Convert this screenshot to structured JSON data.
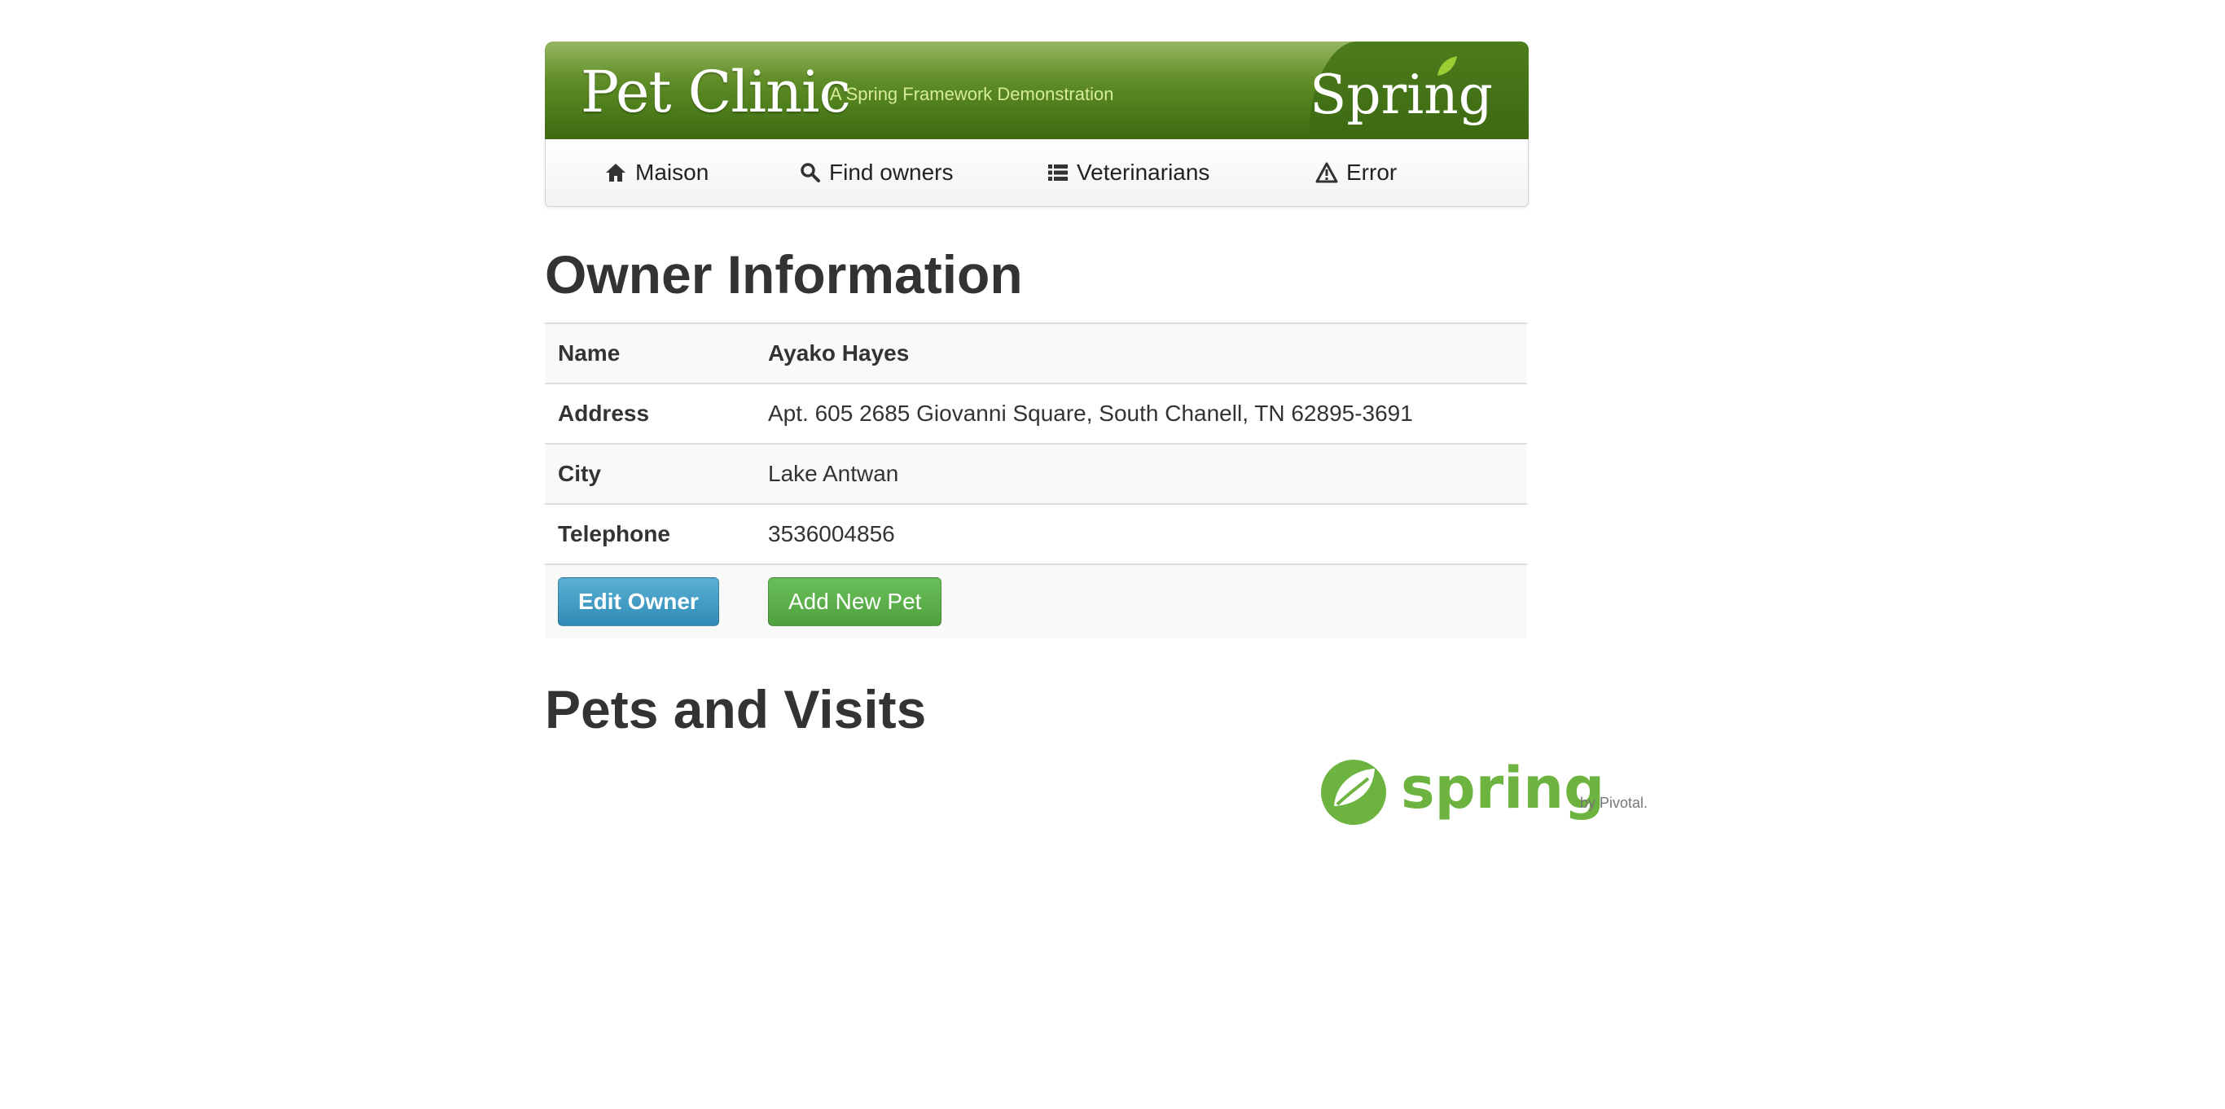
{
  "header": {
    "brand_title": "Pet Clinic",
    "brand_subtitle": "A Spring Framework Demonstration",
    "spring_word": "Spring"
  },
  "nav": {
    "items": [
      {
        "label": "Maison",
        "icon": "home-icon"
      },
      {
        "label": "Find owners",
        "icon": "search-icon"
      },
      {
        "label": "Veterinarians",
        "icon": "list-icon"
      },
      {
        "label": "Error",
        "icon": "warning-icon"
      }
    ]
  },
  "owner": {
    "heading": "Owner Information",
    "rows": [
      {
        "label": "Name",
        "value": "Ayako Hayes"
      },
      {
        "label": "Address",
        "value": "Apt. 605 2685 Giovanni Square, South Chanell, TN 62895-3691"
      },
      {
        "label": "City",
        "value": "Lake Antwan"
      },
      {
        "label": "Telephone",
        "value": "3536004856"
      }
    ],
    "edit_label": "Edit Owner",
    "add_pet_label": "Add New Pet"
  },
  "pets": {
    "heading": "Pets and Visits"
  },
  "footer": {
    "logo_word": "spring",
    "logo_byline": "by Pivotal."
  },
  "colors": {
    "brand_green": "#5c8a24",
    "spring_green": "#6db33f",
    "edit_blue": "#2f8ab6",
    "add_green": "#4ea13d"
  }
}
